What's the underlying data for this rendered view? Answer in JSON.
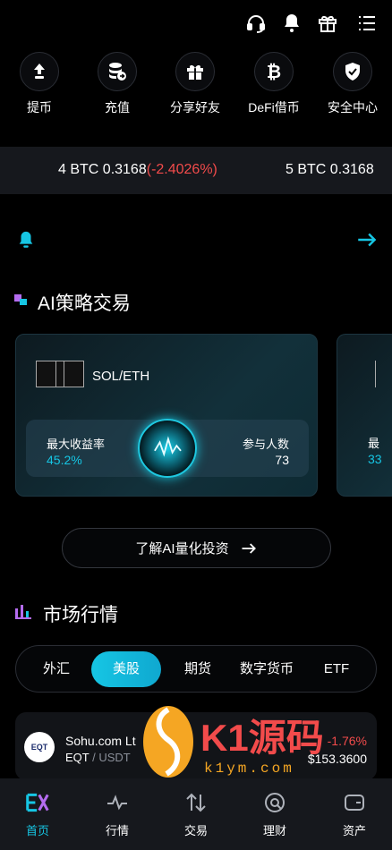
{
  "topbar": {
    "icons": [
      "headset-icon",
      "bell-icon",
      "gift-icon",
      "menu-icon"
    ]
  },
  "quick_actions": [
    {
      "label": "提币",
      "icon": "withdraw-arrow-icon"
    },
    {
      "label": "充值",
      "icon": "coin-stack-icon"
    },
    {
      "label": "分享好友",
      "icon": "gift-icon"
    },
    {
      "label": "DeFi借币",
      "icon": "bitcoin-icon"
    },
    {
      "label": "安全中心",
      "icon": "shield-check-icon"
    }
  ],
  "ticker": {
    "item1_prefix": "4 BTC 0.3168",
    "item1_change": "(-2.4026%)",
    "item2_prefix": "5 BTC 0.3168"
  },
  "ai_strategy": {
    "title": "AI策略交易",
    "pair": "SOL/ETH",
    "max_return_label": "最大收益率",
    "max_return_value": "45.2%",
    "participants_label": "参与人数",
    "participants_value": "73",
    "second_card_label": "最",
    "second_card_value": "33",
    "learn_button": "了解AI量化投资"
  },
  "market": {
    "title": "市场行情",
    "tabs": [
      "外汇",
      "美股",
      "期货",
      "数字货币",
      "ETF"
    ],
    "active_tab": "美股",
    "rows": [
      {
        "logo": "EQT",
        "name": "Sohu.com Lt",
        "symbol": "EQT",
        "quote": "USDT",
        "change": "-1.76%",
        "price": "$153.3600"
      }
    ]
  },
  "watermark": {
    "brand": "K1源码",
    "domain": "k1ym.com"
  },
  "bottom_nav": [
    {
      "label": "首页",
      "icon": "home-logo-icon",
      "active": true
    },
    {
      "label": "行情",
      "icon": "pulse-icon",
      "active": false
    },
    {
      "label": "交易",
      "icon": "swap-icon",
      "active": false
    },
    {
      "label": "理财",
      "icon": "finance-icon",
      "active": false
    },
    {
      "label": "资产",
      "icon": "wallet-icon",
      "active": false
    }
  ],
  "colors": {
    "accent": "#16c6e4",
    "negative": "#f24b4b",
    "background": "#000000",
    "panel": "#16181d"
  }
}
